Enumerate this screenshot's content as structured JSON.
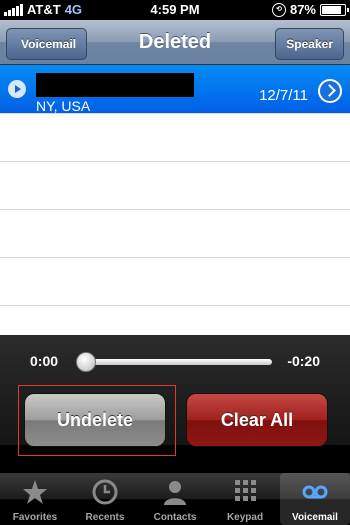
{
  "status": {
    "carrier": "AT&T",
    "network": "4G",
    "time": "4:59 PM",
    "battery": "87%",
    "battery_level": 0.87
  },
  "nav": {
    "back_label": "Voicemail",
    "title": "Deleted",
    "right_label": "Speaker"
  },
  "voicemails": [
    {
      "location": "NY, USA",
      "date": "12/7/11"
    }
  ],
  "player": {
    "elapsed": "0:00",
    "remaining": "-0:20",
    "progress": 0
  },
  "actions": {
    "undelete_label": "Undelete",
    "clear_label": "Clear All"
  },
  "tabs": [
    {
      "label": "Favorites",
      "icon": "star-icon"
    },
    {
      "label": "Recents",
      "icon": "clock-icon"
    },
    {
      "label": "Contacts",
      "icon": "person-icon"
    },
    {
      "label": "Keypad",
      "icon": "keypad-icon"
    },
    {
      "label": "Voicemail",
      "icon": "voicemail-icon"
    }
  ],
  "colors": {
    "selection": "#0a74ec",
    "danger": "#a0201d",
    "nav": "#6d84a2"
  }
}
